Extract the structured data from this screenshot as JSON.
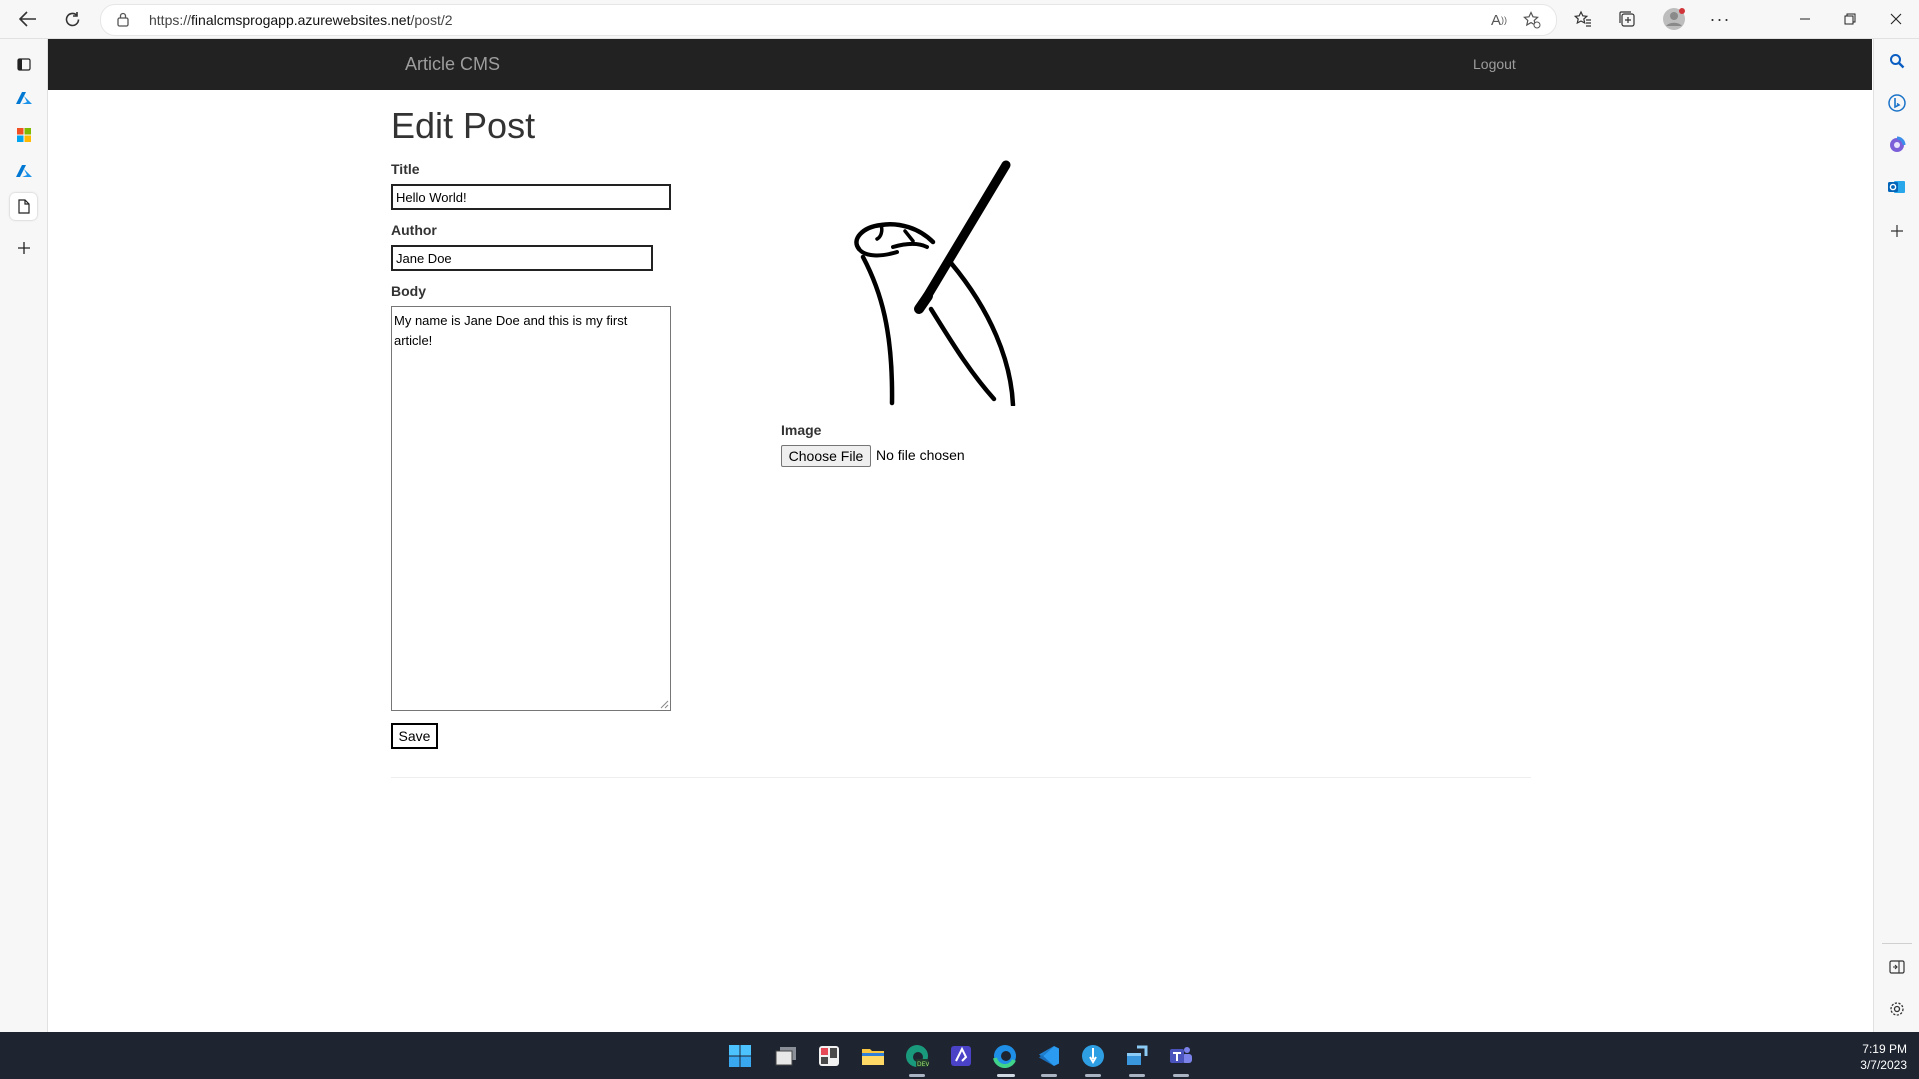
{
  "browser": {
    "url_prefix": "https://",
    "url_domain": "finalcmsprogapp.azurewebsites.net",
    "url_path": "/post/2"
  },
  "navbar": {
    "brand": "Article CMS",
    "logout": "Logout"
  },
  "form": {
    "heading": "Edit Post",
    "title_label": "Title",
    "title_value": "Hello World!",
    "author_label": "Author",
    "author_value": "Jane Doe",
    "body_label": "Body",
    "body_value": "My name is Jane Doe and this is my first article!",
    "save_label": "Save",
    "image_label": "Image",
    "choose_file_label": "Choose File",
    "no_file_text": "No file chosen"
  },
  "taskbar": {
    "time": "7:19 PM",
    "date": "3/7/2023",
    "apps": [
      "start-icon",
      "task-view-icon",
      "widgets-icon",
      "file-explorer-icon",
      "edge-dev-icon",
      "powerapps-icon",
      "edge-icon",
      "vscode-icon",
      "postman-icon",
      "azure-storage-icon",
      "teams-icon"
    ]
  },
  "colors": {
    "navbar_bg": "#222222",
    "navbar_text": "#9d9d9d",
    "taskbar_bg": "#1e2530"
  }
}
